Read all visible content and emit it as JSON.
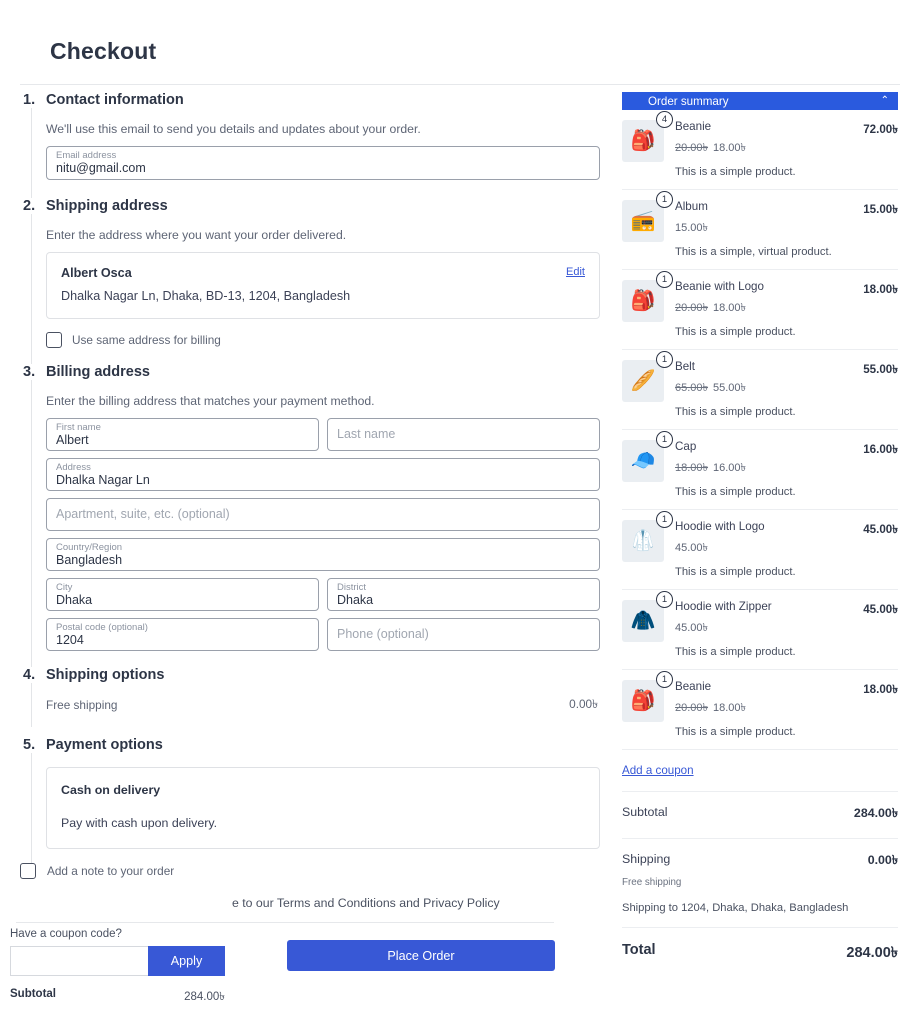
{
  "page": {
    "title": "Checkout"
  },
  "sections": {
    "contact": {
      "num": "1.",
      "title": "Contact information",
      "desc": "We'll use this email to send you details and updates about your order.",
      "email_label": "Email address",
      "email_value": "nitu@gmail.com"
    },
    "shipping_address": {
      "num": "2.",
      "title": "Shipping address",
      "desc": "Enter the address where you want your order delivered.",
      "name": "Albert Osca",
      "address": "Dhalka Nagar Ln, Dhaka, BD-13, 1204, Bangladesh",
      "edit_label": "Edit",
      "same_billing_label": "Use same address for billing"
    },
    "billing_address": {
      "num": "3.",
      "title": "Billing address",
      "desc": "Enter the billing address that matches your payment method.",
      "first_name_label": "First name",
      "first_name_value": "Albert",
      "last_name_placeholder": "Last name",
      "address_label": "Address",
      "address_value": "Dhalka Nagar Ln",
      "apartment_placeholder": "Apartment, suite, etc. (optional)",
      "country_label": "Country/Region",
      "country_value": "Bangladesh",
      "city_label": "City",
      "city_value": "Dhaka",
      "district_label": "District",
      "district_value": "Dhaka",
      "postal_label": "Postal code (optional)",
      "postal_value": "1204",
      "phone_placeholder": "Phone (optional)"
    },
    "shipping_options": {
      "num": "4.",
      "title": "Shipping options",
      "method": "Free shipping",
      "price": "0.00৳"
    },
    "payment_options": {
      "num": "5.",
      "title": "Payment options",
      "method_title": "Cash on delivery",
      "method_desc": "Pay with cash upon delivery."
    }
  },
  "footer": {
    "note_label": "Add a note to your order",
    "terms_text": "e to our Terms and Conditions and Privacy Policy",
    "place_order_label": "Place Order"
  },
  "coupon_widget": {
    "question": "Have a coupon code?",
    "input_value": "",
    "apply_label": "Apply",
    "subtotal_label": "Subtotal",
    "subtotal_value": "284.00৳"
  },
  "order_summary": {
    "header": "Order summary",
    "chevron": "⌃",
    "items": [
      {
        "qty": "4",
        "name": "Beanie",
        "was": "20.00৳",
        "now": "18.00৳",
        "desc": "This is a simple product.",
        "total": "72.00৳",
        "icon": "🎒",
        "icon_color": "#ef8e7e"
      },
      {
        "qty": "1",
        "name": "Album",
        "was": "",
        "now": "15.00৳",
        "desc": "This is a simple, virtual product.",
        "total": "15.00৳",
        "icon": "📻",
        "icon_color": "#c7a8c4"
      },
      {
        "qty": "1",
        "name": "Beanie with Logo",
        "was": "20.00৳",
        "now": "18.00৳",
        "desc": "This is a simple product.",
        "total": "18.00৳",
        "icon": "🎒",
        "icon_color": "#8fc4d6"
      },
      {
        "qty": "1",
        "name": "Belt",
        "was": "65.00৳",
        "now": "55.00৳",
        "desc": "This is a simple product.",
        "total": "55.00৳",
        "icon": "🥖",
        "icon_color": "#9c7a52"
      },
      {
        "qty": "1",
        "name": "Cap",
        "was": "18.00৳",
        "now": "16.00৳",
        "desc": "This is a simple product.",
        "total": "16.00৳",
        "icon": "🧢",
        "icon_color": "#e8d9a8"
      },
      {
        "qty": "1",
        "name": "Hoodie with Logo",
        "was": "",
        "now": "45.00৳",
        "desc": "This is a simple product.",
        "total": "45.00৳",
        "icon": "🥼",
        "icon_color": "#b8cfd8"
      },
      {
        "qty": "1",
        "name": "Hoodie with Zipper",
        "was": "",
        "now": "45.00৳",
        "desc": "This is a simple product.",
        "total": "45.00৳",
        "icon": "🧥",
        "icon_color": "#6fc5a8"
      },
      {
        "qty": "1",
        "name": "Beanie",
        "was": "20.00৳",
        "now": "18.00৳",
        "desc": "This is a simple product.",
        "total": "18.00৳",
        "icon": "🎒",
        "icon_color": "#ef8e7e"
      }
    ],
    "add_coupon_label": "Add a coupon",
    "subtotal_label": "Subtotal",
    "subtotal_value": "284.00৳",
    "shipping_label": "Shipping",
    "shipping_value": "0.00৳",
    "shipping_method": "Free shipping",
    "shipping_to": "Shipping to 1204, Dhaka, Dhaka, Bangladesh",
    "total_label": "Total",
    "total_value": "284.00৳"
  },
  "colors": {
    "accent": "#3858d6",
    "header_blue": "#2a5ade",
    "text": "#3c4257"
  }
}
